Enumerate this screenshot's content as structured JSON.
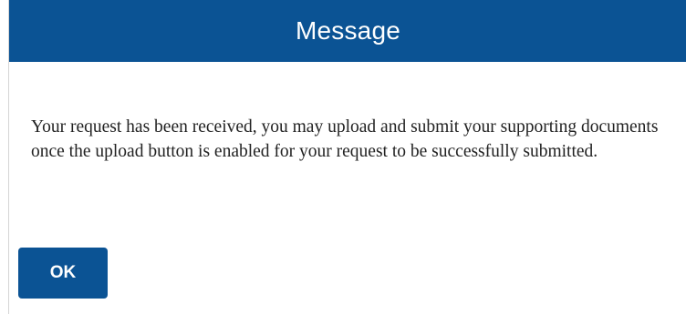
{
  "dialog": {
    "title": "Message",
    "message": "Your request has been received, you may upload and submit your supporting documents once the upload button is enabled for your request to be successfully submitted.",
    "ok_label": "OK"
  },
  "colors": {
    "header_background": "#0b5394",
    "button_background": "#0b5394",
    "header_text": "#ffffff",
    "body_text": "#222222"
  }
}
